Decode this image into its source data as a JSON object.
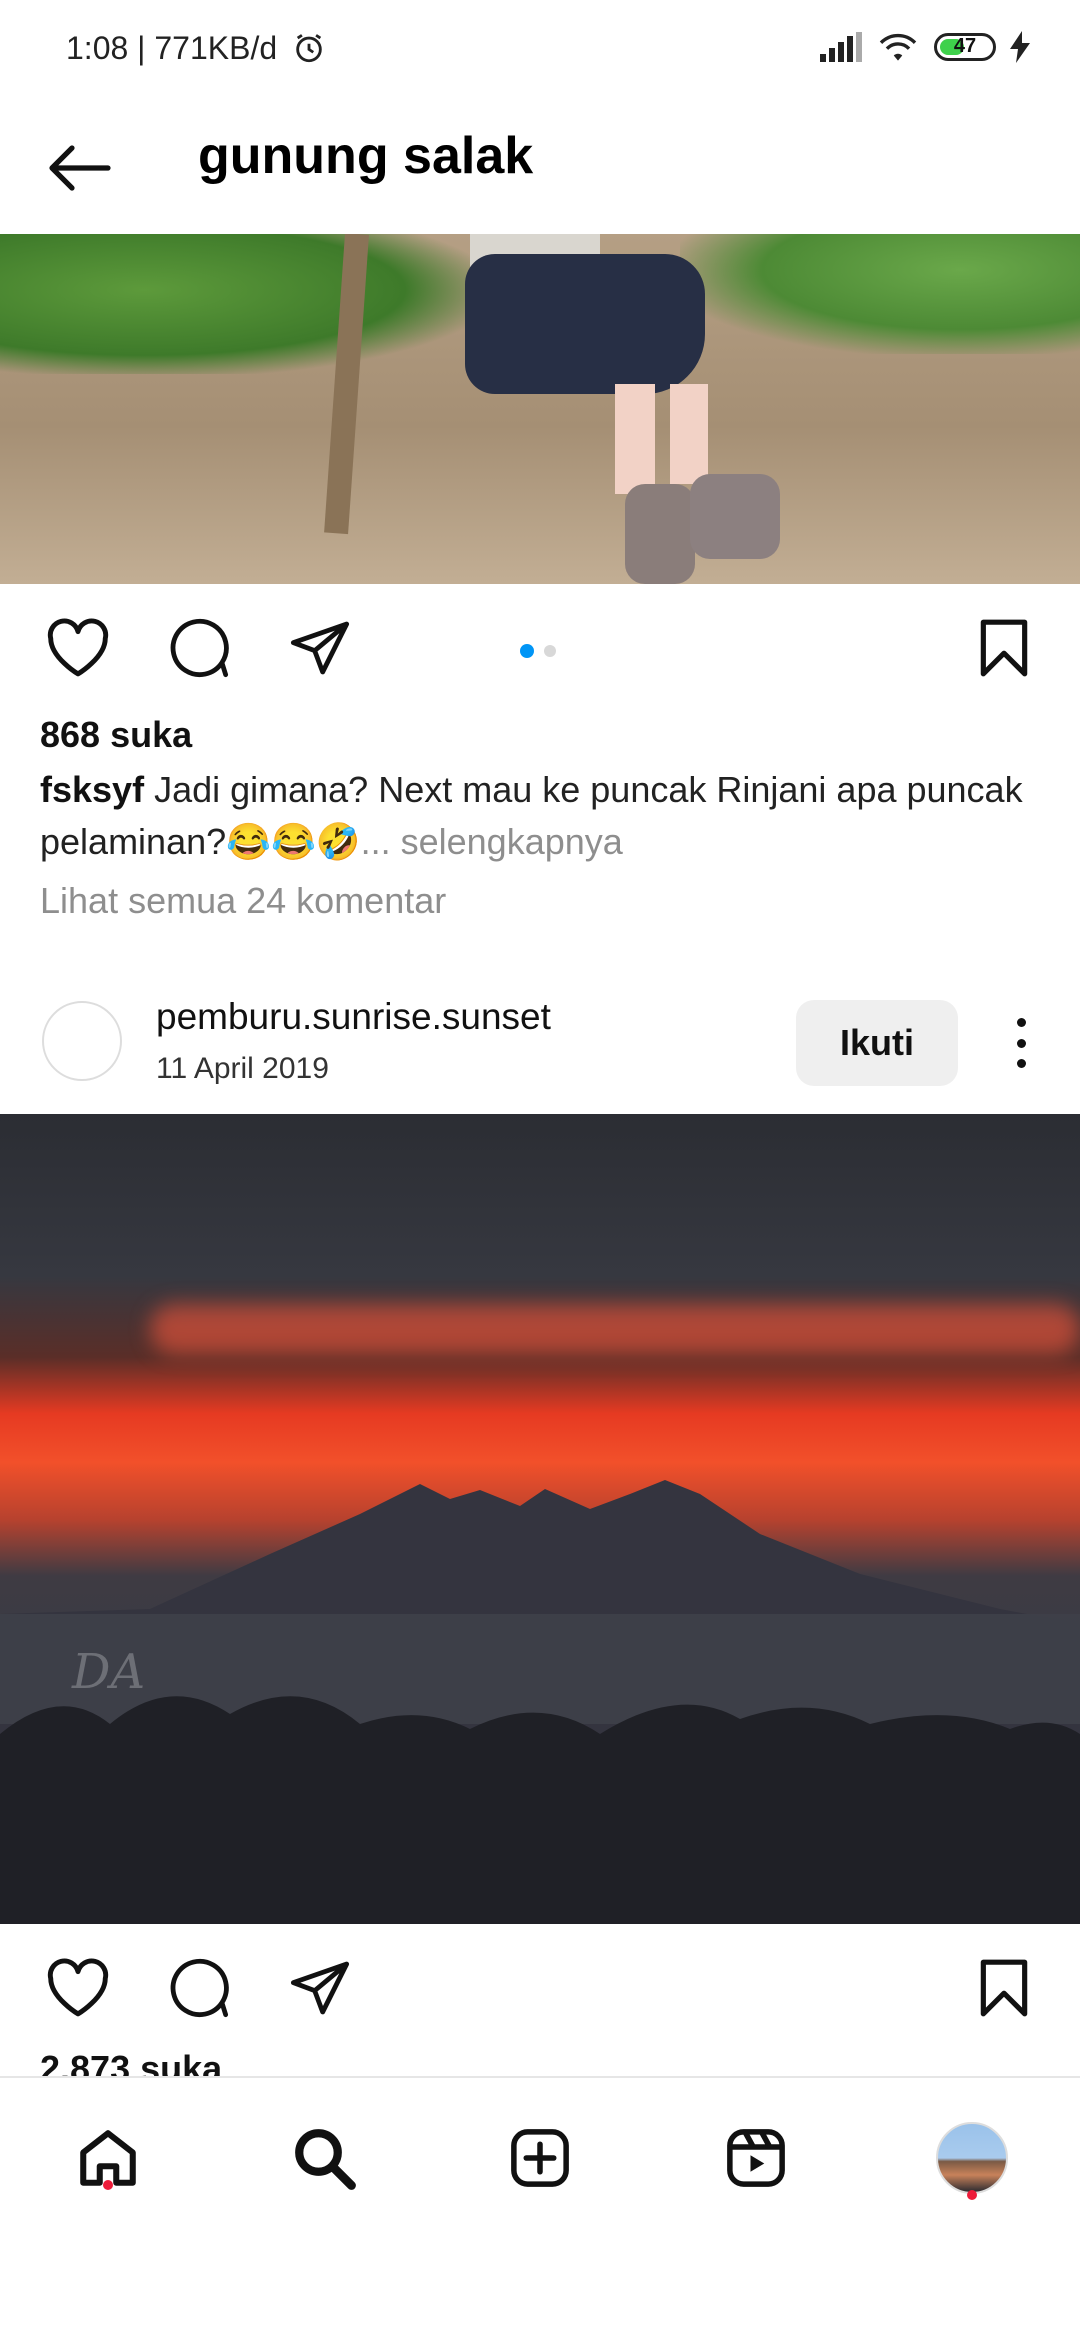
{
  "status_bar": {
    "time": "1:08 | 771KB/d",
    "battery_level": "47",
    "battery_fraction": 0.47,
    "icons": [
      "alarm-icon",
      "signal-icon",
      "wifi-icon",
      "battery-icon",
      "charging-icon"
    ]
  },
  "header": {
    "title": "gunung salak",
    "back_icon": "arrow-left-icon"
  },
  "post1": {
    "likes": "868 suka",
    "caption_user": "fsksyf",
    "caption_text": " Jadi gimana? Next mau ke puncak Rinjani apa puncak pelaminan?😂😂🤣",
    "caption_more": "... selengkapnya",
    "comments_link": "Lihat semua 24 komentar",
    "carousel_count": 2,
    "carousel_active": 1
  },
  "post2": {
    "username": "pemburu.sunrise.sunset",
    "date": "11 April 2019",
    "follow_label": "Ikuti",
    "likes": "2.873 suka",
    "watermark": "DA"
  },
  "colors": {
    "accent_blue": "#0095f6",
    "notification_red": "#ed1c3a",
    "muted_text": "#8e8e8e",
    "follow_button_bg": "#efefef"
  },
  "bottom_nav": {
    "items": [
      "home-icon",
      "search-icon",
      "new-post-icon",
      "reels-icon",
      "profile-avatar"
    ]
  }
}
